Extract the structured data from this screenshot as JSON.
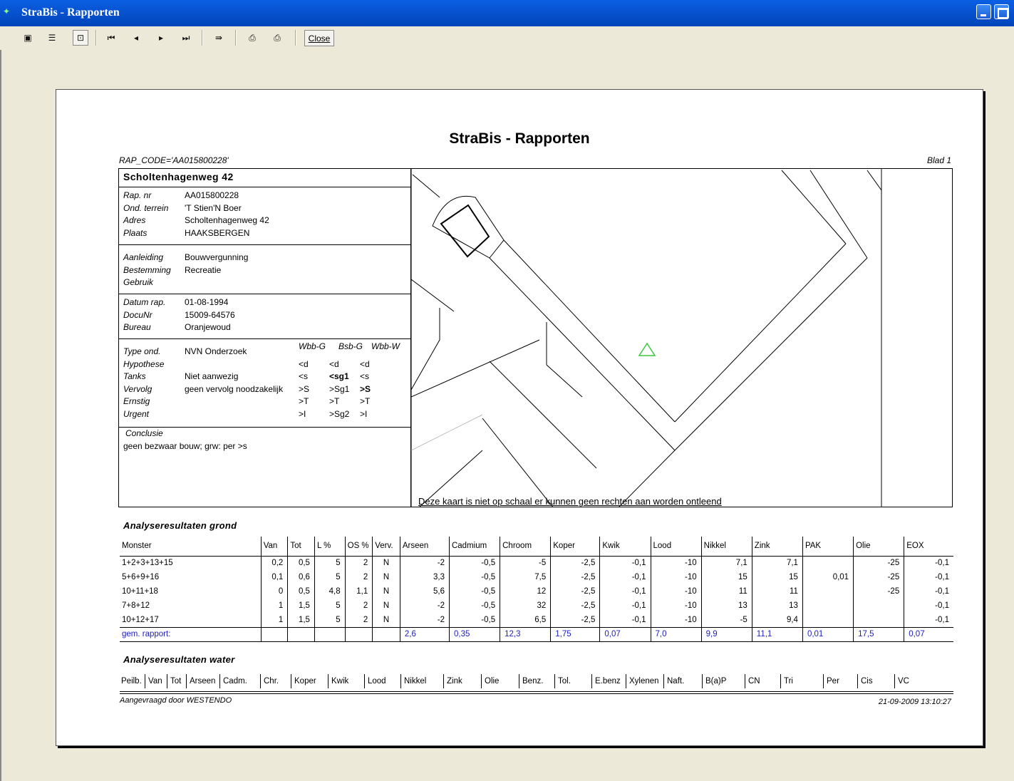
{
  "window": {
    "title": "StraBis - Rapporten"
  },
  "toolbar": {
    "close_label": "Close"
  },
  "report": {
    "title": "StraBis - Rapporten",
    "rap_code": "RAP_CODE='AA015800228'",
    "page": "Blad 1",
    "location": "Scholtenhagenweg 42",
    "details": [
      {
        "label": "Rap. nr",
        "value": "AA015800228"
      },
      {
        "label": "Ond. terrein",
        "value": "'T Stien'N Boer"
      },
      {
        "label": "Adres",
        "value": "Scholtenhagenweg 42"
      },
      {
        "label": "Plaats",
        "value": "HAAKSBERGEN"
      }
    ],
    "purpose": [
      {
        "label": "Aanleiding",
        "value": "Bouwvergunning"
      },
      {
        "label": "Bestemming",
        "value": "Recreatie"
      },
      {
        "label": "Gebruik",
        "value": ""
      }
    ],
    "dates": [
      {
        "label": "Datum rap.",
        "value": "01-08-1994"
      },
      {
        "label": "DocuNr",
        "value": "15009-64576"
      },
      {
        "label": "Bureau",
        "value": "Oranjewoud"
      }
    ],
    "grade_headers": [
      "Wbb-G",
      "Bsb-G",
      "Wbb-W"
    ],
    "assessment": [
      {
        "label": "Type ond.",
        "value": "NVN Onderzoek",
        "g1": "",
        "g2": "",
        "g3": ""
      },
      {
        "label": "Hypothese",
        "value": "",
        "g1": "<d",
        "g2": "<d",
        "g3": "<d"
      },
      {
        "label": "Tanks",
        "value": "Niet aanwezig",
        "g1": "<s",
        "g2": "<sg1",
        "g3": "<s"
      },
      {
        "label": "Vervolg",
        "value": "geen vervolg noodzakelijk",
        "g1": ">S",
        "g2": ">Sg1",
        "g3": ">S"
      },
      {
        "label": "Ernstig",
        "value": "",
        "g1": ">T",
        "g2": ">T",
        "g3": ">T"
      },
      {
        "label": "Urgent",
        "value": "",
        "g1": ">I",
        "g2": ">Sg2",
        "g3": ">I"
      }
    ],
    "conclusion_label": "Conclusie",
    "conclusion": "geen bezwaar bouw; grw: per >s",
    "map_note": "Deze kaart is niet op schaal er kunnen geen rechten aan worden ontleend"
  },
  "grond": {
    "title": "Analyseresultaten grond",
    "columns": [
      "Monster",
      "Van",
      "Tot",
      "L %",
      "OS %",
      "Verv.",
      "Arseen",
      "Cadmium",
      "Chroom",
      "Koper",
      "Kwik",
      "Lood",
      "Nikkel",
      "Zink",
      "PAK",
      "Olie",
      "EOX"
    ],
    "rows": [
      [
        "1+2+3+13+15",
        "0,2",
        "0,5",
        "5",
        "2",
        "N",
        "-2",
        "-0,5",
        "-5",
        "-2,5",
        "-0,1",
        "-10",
        "7,1",
        "7,1",
        "",
        "-25",
        "-0,1"
      ],
      [
        "5+6+9+16",
        "0,1",
        "0,6",
        "5",
        "2",
        "N",
        "3,3",
        "-0,5",
        "7,5",
        "-2,5",
        "-0,1",
        "-10",
        "15",
        "15",
        "0,01",
        "-25",
        "-0,1"
      ],
      [
        "10+11+18",
        "0",
        "0,5",
        "4,8",
        "1,1",
        "N",
        "5,6",
        "-0,5",
        "12",
        "-2,5",
        "-0,1",
        "-10",
        "11",
        "11",
        "",
        "-25",
        "-0,1"
      ],
      [
        "7+8+12",
        "1",
        "1,5",
        "5",
        "2",
        "N",
        "-2",
        "-0,5",
        "32",
        "-2,5",
        "-0,1",
        "-10",
        "13",
        "13",
        "",
        "",
        "-0,1"
      ],
      [
        "10+12+17",
        "1",
        "1,5",
        "5",
        "2",
        "N",
        "-2",
        "-0,5",
        "6,5",
        "-2,5",
        "-0,1",
        "-10",
        "-5",
        "9,4",
        "",
        "",
        "-0,1"
      ]
    ],
    "average": [
      "gem. rapport:",
      "",
      "",
      "",
      "",
      "",
      "2,6",
      "0,35",
      "12,3",
      "1,75",
      "0,07",
      "7,0",
      "9,9",
      "11,1",
      "0,01",
      "17,5",
      "0,07"
    ]
  },
  "water": {
    "title": "Analyseresultaten water",
    "columns": [
      "Peilb.",
      "Van",
      "Tot",
      "Arseen",
      "Cadm.",
      "Chr.",
      "Koper",
      "Kwik",
      "Lood",
      "Nikkel",
      "Zink",
      "Olie",
      "Benz.",
      "Tol.",
      "E.benz",
      "Xylenen",
      "Naft.",
      "B(a)P",
      "CN",
      "Tri",
      "Per",
      "Cis",
      "VC"
    ]
  },
  "footer": {
    "requested_by": "Aangevraagd door WESTENDO",
    "timestamp": "21-09-2009 13:10:27"
  }
}
